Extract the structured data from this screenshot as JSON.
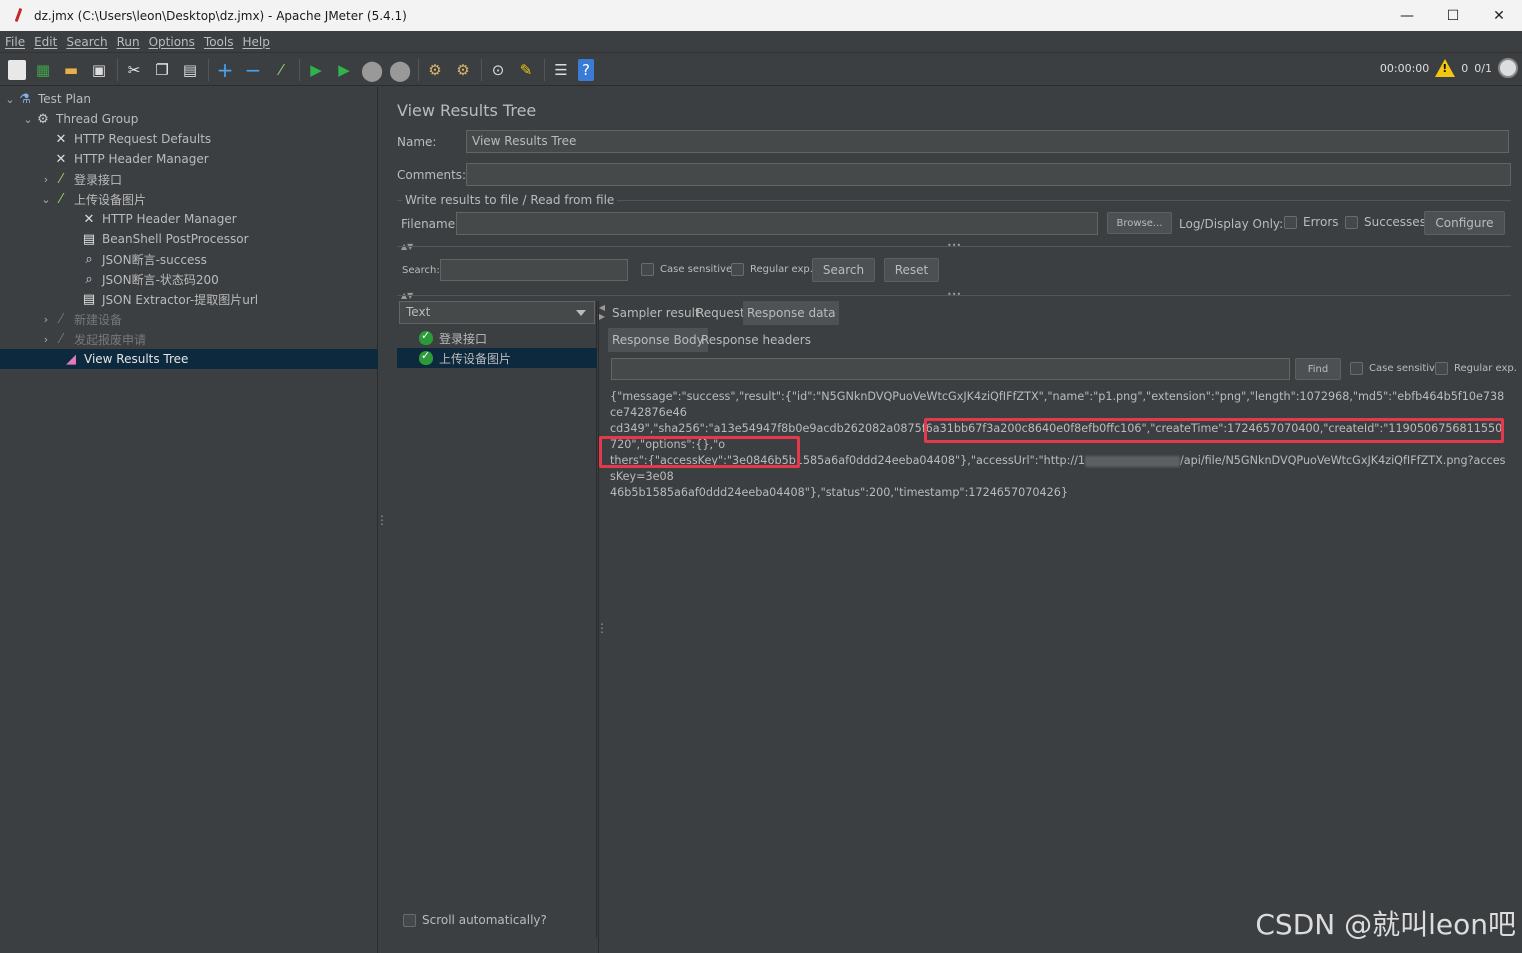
{
  "window": {
    "title": "dz.jmx (C:\\Users\\leon\\Desktop\\dz.jmx) - Apache JMeter (5.4.1)",
    "minimize": "—",
    "maximize": "☐",
    "close": "✕"
  },
  "menu": [
    "File",
    "Edit",
    "Search",
    "Run",
    "Options",
    "Tools",
    "Help"
  ],
  "toolbar": {
    "timer": "00:00:00",
    "warnings": "0",
    "threads": "0/1"
  },
  "tree": [
    {
      "label": "Test Plan",
      "icon": "flask-icon"
    },
    {
      "label": "Thread Group",
      "icon": "gear-icon"
    },
    {
      "label": "HTTP Request Defaults",
      "icon": "tools-icon"
    },
    {
      "label": "HTTP Header Manager",
      "icon": "tools-icon"
    },
    {
      "label": "登录接口",
      "icon": "pipette-icon"
    },
    {
      "label": "上传设备图片",
      "icon": "pipette-icon"
    },
    {
      "label": "HTTP Header Manager",
      "icon": "tools-icon"
    },
    {
      "label": "BeanShell PostProcessor",
      "icon": "script-icon"
    },
    {
      "label": "JSON断言-success",
      "icon": "magnifier-icon"
    },
    {
      "label": "JSON断言-状态码200",
      "icon": "magnifier-icon"
    },
    {
      "label": "JSON Extractor-提取图片url",
      "icon": "script-icon"
    },
    {
      "label": "新建设备",
      "icon": "pipette-icon"
    },
    {
      "label": "发起报废申请",
      "icon": "pipette-icon"
    },
    {
      "label": "View Results Tree",
      "icon": "chart-icon"
    }
  ],
  "panel": {
    "title": "View Results Tree",
    "name_label": "Name:",
    "name_value": "View Results Tree",
    "comments_label": "Comments:",
    "file_group": "Write results to file / Read from file",
    "filename_label": "Filename",
    "browse": "Browse...",
    "log_display": "Log/Display Only:",
    "errors": "Errors",
    "successes": "Successes",
    "configure": "Configure",
    "search_label": "Search:",
    "case_sensitive": "Case sensitive",
    "regular_exp": "Regular exp.",
    "search_btn": "Search",
    "reset_btn": "Reset",
    "renderer": "Text",
    "scroll_auto": "Scroll automatically?"
  },
  "results": [
    {
      "label": "登录接口",
      "status": "success"
    },
    {
      "label": "上传设备图片",
      "status": "success"
    }
  ],
  "tabs": {
    "sampler_result": "Sampler result",
    "request": "Request",
    "response_data": "Response data",
    "response_body": "Response Body",
    "response_headers": "Response headers",
    "find": "Find"
  },
  "response": {
    "line1": "{\"message\":\"success\",\"result\":{\"id\":\"N5GNknDVQPuoVeWtcGxJK4ziQfIFfZTX\",\"name\":\"p1.png\",\"extension\":\"png\",\"length\":1072968,\"md5\":\"ebfb464b5f10e738ce742876e46",
    "line2": "cd349\",\"sha256\":\"a13e54947f8b0e9acdb262082a0875f6a31bb67f3a200c8640e0f8efb0ffc106\",\"createTime\":1724657070400,\"createId\":\"1190506756811550720\",\"options\":{},\"o",
    "line3a": "thers\":{\"accessKey\":\"3e0846b5b1585a6af0ddd24eeba04408\"},\"accessUrl\":\"http://1",
    "line3b": "/api/file/N5GNknDVQPuoVeWtcGxJK4ziQfIFfZTX.png?accessKey=3e08",
    "line4a": "46b5b1585a6af0ddd24eeba04408\"}",
    "line4b": ",\"status\":200,\"timestamp\":1724657070426}"
  },
  "watermark": "CSDN @就叫leon吧",
  "colors": {
    "background": "#3c3f41",
    "selection": "#0d293e",
    "highlight": "#e5394b"
  }
}
